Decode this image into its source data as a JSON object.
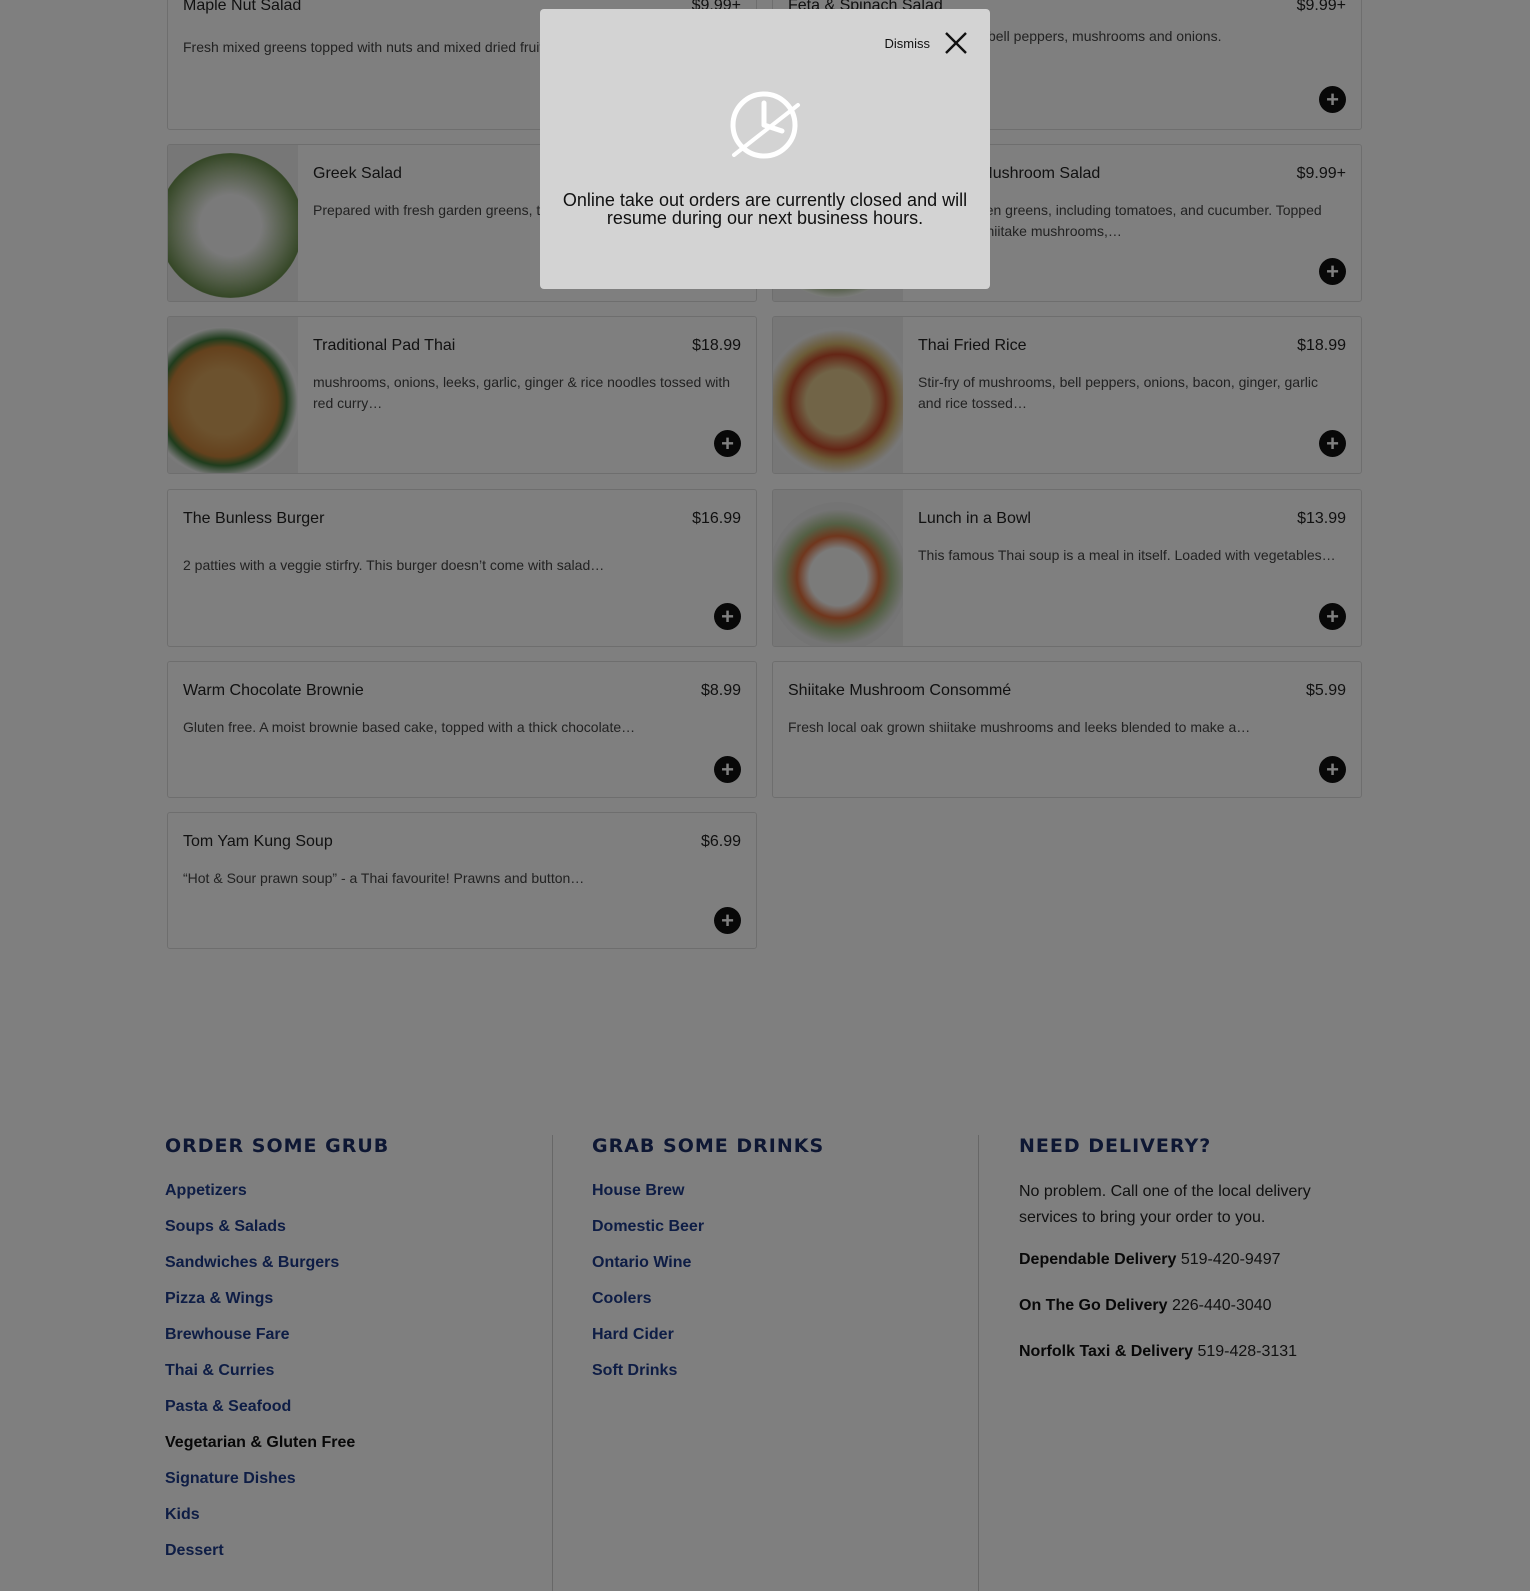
{
  "menu": {
    "items": [
      {
        "name": "Maple Nut Salad",
        "price": "$9.99+",
        "desc": "Fresh mixed greens topped with nuts and mixed dried fruit…"
      },
      {
        "name": "Feta & Spinach Salad",
        "price": "$9.99+",
        "desc": "Spinach, tomatoes, cucumbers, bell peppers, mushrooms and onions."
      },
      {
        "name": "Greek Salad",
        "price": "",
        "desc": "Prepared with fresh garden greens, tomato, bell peppers,…"
      },
      {
        "name": "Shiitake Mushroom Salad",
        "price": "$9.99+",
        "desc": "Fresh garden greens, including tomatoes, and cucumber. Topped with local shiitake mushrooms,…"
      },
      {
        "name": "Traditional Pad Thai",
        "price": "$18.99",
        "desc": "mushrooms, onions, leeks, garlic, ginger & rice noodles tossed with red curry…"
      },
      {
        "name": "Thai Fried Rice",
        "price": "$18.99",
        "desc": "Stir-fry of mushrooms, bell peppers, onions, bacon, ginger, garlic and rice tossed…"
      },
      {
        "name": "The Bunless Burger",
        "price": "$16.99",
        "desc": "2 patties with a veggie stirfry. This burger doesn’t come with salad…"
      },
      {
        "name": "Lunch in a Bowl",
        "price": "$13.99",
        "desc": "This famous Thai soup is a meal in itself. Loaded with vegetables…"
      },
      {
        "name": "Warm Chocolate Brownie",
        "price": "$8.99",
        "desc": "Gluten free. A moist brownie based cake, topped with a thick chocolate…"
      },
      {
        "name": "Shiitake Mushroom Consommé",
        "price": "$5.99",
        "desc": "Fresh local oak grown shiitake mushrooms and leeks blended to make a…"
      },
      {
        "name": "Tom Yam Kung Soup",
        "price": "$6.99",
        "desc": "“Hot & Sour prawn soup” - a Thai favourite! Prawns and button…"
      }
    ],
    "add_icon": "plus-circle-icon",
    "add_glyph": "+"
  },
  "footer": {
    "grub": {
      "title": "ORDER SOME GRUB",
      "links": [
        "Appetizers",
        "Soups & Salads",
        "Sandwiches & Burgers",
        "Pizza & Wings",
        "Brewhouse Fare",
        "Thai & Curries",
        "Pasta & Seafood",
        "Vegetarian & Gluten Free",
        "Signature Dishes",
        "Kids",
        "Dessert"
      ]
    },
    "drinks": {
      "title": "GRAB SOME DRINKS",
      "links": [
        "House Brew",
        "Domestic Beer",
        "Ontario Wine",
        "Coolers",
        "Hard Cider",
        "Soft Drinks"
      ]
    },
    "delivery": {
      "title": "NEED DELIVERY?",
      "text": "No problem. Call one of the local delivery services to bring your order to you.",
      "services": [
        {
          "name": "Dependable Delivery",
          "phone": "519-420-9497"
        },
        {
          "name": "On The Go Delivery",
          "phone": "226-440-3040"
        },
        {
          "name": "Norfolk Taxi & Delivery",
          "phone": "519-428-3131"
        }
      ]
    }
  },
  "modal": {
    "dismiss_label": "Dismiss",
    "close_icon": "close-icon",
    "clock_icon": "clock-slash-icon",
    "message": "Online take out orders are currently closed and will resume during our next business hours."
  },
  "colors": {
    "footer_heading": "#1c2f66",
    "footer_link": "#1d3a8a",
    "overlay": "rgba(0,0,0,0.5)",
    "modal_bg": "#d3d3d3"
  }
}
